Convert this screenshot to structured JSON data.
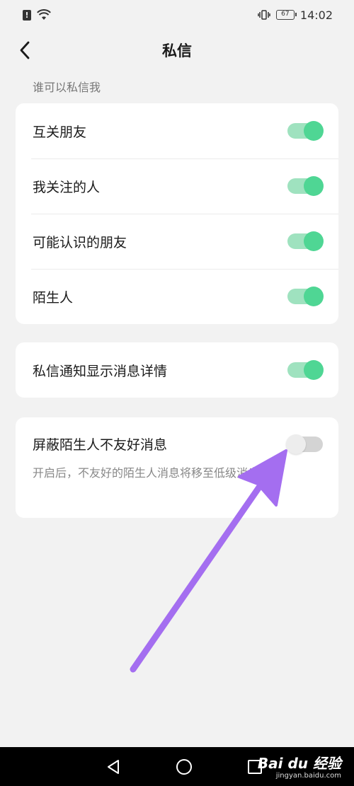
{
  "status_bar": {
    "alert": "!",
    "battery": "67",
    "time": "14:02"
  },
  "header": {
    "title": "私信"
  },
  "section": {
    "label": "谁可以私信我"
  },
  "who_can_message": [
    {
      "label": "互关朋友",
      "on": true
    },
    {
      "label": "我关注的人",
      "on": true
    },
    {
      "label": "可能认识的朋友",
      "on": true
    },
    {
      "label": "陌生人",
      "on": true
    }
  ],
  "notification_detail": {
    "label": "私信通知显示消息详情",
    "on": true
  },
  "block_unfriendly": {
    "label": "屏蔽陌生人不友好消息",
    "description": "开启后，不友好的陌生人消息将移至低级消息盒子",
    "on": false
  },
  "colors": {
    "accent": "#4fd694",
    "track_on": "#9fe2bf",
    "arrow": "#a46ef0"
  },
  "watermark": {
    "logo": "Bai du 经验",
    "url": "jingyan.baidu.com"
  }
}
